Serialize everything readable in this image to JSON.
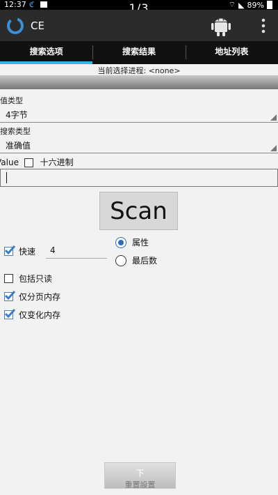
{
  "status": {
    "time": "12:37",
    "battery": "89%"
  },
  "pager": "1/3",
  "app": {
    "title": "CE"
  },
  "tabs": [
    "搜索选项",
    "搜索结果",
    "地址列表"
  ],
  "process_line": "当前选择进程: <none>",
  "value_type": {
    "label": "值类型",
    "value": "4字节"
  },
  "search_type": {
    "label": "搜索类型",
    "value": "准确值"
  },
  "value_row": {
    "label": "Value",
    "hex_label": "十六进制"
  },
  "scan_button": "Scan",
  "fast": {
    "label": "快速",
    "value": "4",
    "checked": true
  },
  "radio_group": [
    {
      "label": "属性",
      "checked": true
    },
    {
      "label": "最后数",
      "checked": false
    }
  ],
  "checkboxes": [
    {
      "label": "包括只读",
      "checked": false
    },
    {
      "label": "仅分页内存",
      "checked": true
    },
    {
      "label": "仅变化内存",
      "checked": true
    }
  ],
  "bottom_button": {
    "label": "下",
    "sub": "重置設置"
  }
}
